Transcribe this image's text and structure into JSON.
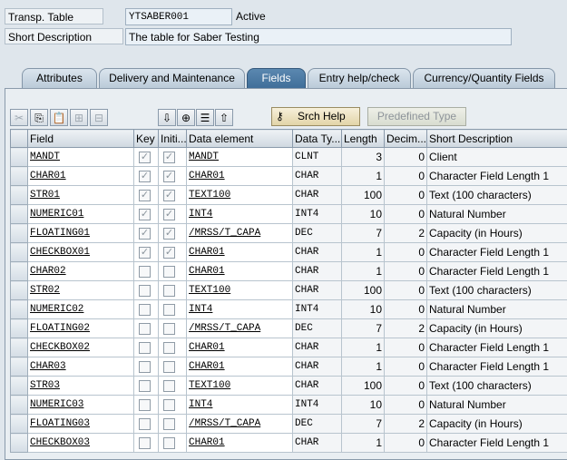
{
  "header": {
    "transp_table_label": "Transp. Table",
    "transp_table_value": "YTSABER001",
    "status": "Active",
    "short_desc_label": "Short Description",
    "short_desc_value": "The table for Saber Testing"
  },
  "tabs": [
    {
      "label": "Attributes",
      "active": false
    },
    {
      "label": "Delivery and Maintenance",
      "active": false
    },
    {
      "label": "Fields",
      "active": true
    },
    {
      "label": "Entry help/check",
      "active": false
    },
    {
      "label": "Currency/Quantity Fields",
      "active": false
    }
  ],
  "toolbar": {
    "icons": [
      "cut-icon",
      "copy-icon",
      "paste-icon",
      "insert-row-icon",
      "delete-row-icon",
      "filter-down-icon",
      "insert-field-icon",
      "sort-icon",
      "sort-up-icon",
      "key-icon"
    ],
    "srch_help_label": "Srch Help",
    "predefined_type_label": "Predefined Type"
  },
  "columns": [
    "Field",
    "Key",
    "Initi...",
    "Data element",
    "Data Ty...",
    "Length",
    "Decim...",
    "Short Description"
  ],
  "rows": [
    {
      "field": "MANDT",
      "key": true,
      "init": true,
      "element": "MANDT",
      "dtype": "CLNT",
      "length": "3",
      "decimals": "0",
      "desc": "Client"
    },
    {
      "field": "CHAR01",
      "key": true,
      "init": true,
      "element": "CHAR01",
      "dtype": "CHAR",
      "length": "1",
      "decimals": "0",
      "desc": "Character Field Length 1"
    },
    {
      "field": "STR01",
      "key": true,
      "init": true,
      "element": "TEXT100",
      "dtype": "CHAR",
      "length": "100",
      "decimals": "0",
      "desc": "Text (100 characters)"
    },
    {
      "field": "NUMERIC01",
      "key": true,
      "init": true,
      "element": "INT4",
      "dtype": "INT4",
      "length": "10",
      "decimals": "0",
      "desc": "Natural Number"
    },
    {
      "field": "FLOATING01",
      "key": true,
      "init": true,
      "element": "/MRSS/T_CAPA",
      "dtype": "DEC",
      "length": "7",
      "decimals": "2",
      "desc": "Capacity (in Hours)"
    },
    {
      "field": "CHECKBOX01",
      "key": true,
      "init": true,
      "element": "CHAR01",
      "dtype": "CHAR",
      "length": "1",
      "decimals": "0",
      "desc": "Character Field Length 1"
    },
    {
      "field": "CHAR02",
      "key": false,
      "init": false,
      "element": "CHAR01",
      "dtype": "CHAR",
      "length": "1",
      "decimals": "0",
      "desc": "Character Field Length 1"
    },
    {
      "field": "STR02",
      "key": false,
      "init": false,
      "element": "TEXT100",
      "dtype": "CHAR",
      "length": "100",
      "decimals": "0",
      "desc": "Text (100 characters)"
    },
    {
      "field": "NUMERIC02",
      "key": false,
      "init": false,
      "element": "INT4",
      "dtype": "INT4",
      "length": "10",
      "decimals": "0",
      "desc": "Natural Number"
    },
    {
      "field": "FLOATING02",
      "key": false,
      "init": false,
      "element": "/MRSS/T_CAPA",
      "dtype": "DEC",
      "length": "7",
      "decimals": "2",
      "desc": "Capacity (in Hours)"
    },
    {
      "field": "CHECKBOX02",
      "key": false,
      "init": false,
      "element": "CHAR01",
      "dtype": "CHAR",
      "length": "1",
      "decimals": "0",
      "desc": "Character Field Length 1"
    },
    {
      "field": "CHAR03",
      "key": false,
      "init": false,
      "element": "CHAR01",
      "dtype": "CHAR",
      "length": "1",
      "decimals": "0",
      "desc": "Character Field Length 1"
    },
    {
      "field": "STR03",
      "key": false,
      "init": false,
      "element": "TEXT100",
      "dtype": "CHAR",
      "length": "100",
      "decimals": "0",
      "desc": "Text (100 characters)"
    },
    {
      "field": "NUMERIC03",
      "key": false,
      "init": false,
      "element": "INT4",
      "dtype": "INT4",
      "length": "10",
      "decimals": "0",
      "desc": "Natural Number"
    },
    {
      "field": "FLOATING03",
      "key": false,
      "init": false,
      "element": "/MRSS/T_CAPA",
      "dtype": "DEC",
      "length": "7",
      "decimals": "2",
      "desc": "Capacity (in Hours)"
    },
    {
      "field": "CHECKBOX03",
      "key": false,
      "init": false,
      "element": "CHAR01",
      "dtype": "CHAR",
      "length": "1",
      "decimals": "0",
      "desc": "Character Field Length 1"
    }
  ],
  "colors": {
    "active_tab": "#4a79a3",
    "background": "#dfe6ec"
  }
}
